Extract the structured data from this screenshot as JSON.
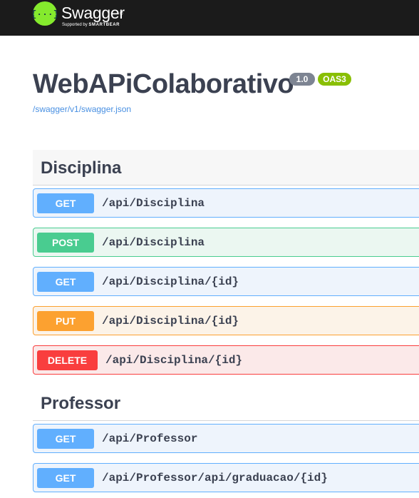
{
  "header": {
    "brand_name": "Swagger",
    "brand_tm": "®",
    "tagline_prefix": "Supported by",
    "tagline_brand": "SMARTBEAR",
    "brand_color": "#85ea2d",
    "icon": "swagger-logo-icon"
  },
  "info": {
    "title": "WebAPiColaborativo",
    "version_badge": "1.0",
    "oas_badge": "OAS3",
    "spec_url": "/swagger/v1/swagger.json"
  },
  "colors": {
    "get": "#61affe",
    "post": "#49cc90",
    "put": "#fca130",
    "delete": "#f93e3e"
  },
  "sections": [
    {
      "name": "Disciplina",
      "operations": [
        {
          "method": "GET",
          "path": "/api/Disciplina"
        },
        {
          "method": "POST",
          "path": "/api/Disciplina"
        },
        {
          "method": "GET",
          "path": "/api/Disciplina/{id}"
        },
        {
          "method": "PUT",
          "path": "/api/Disciplina/{id}"
        },
        {
          "method": "DELETE",
          "path": "/api/Disciplina/{id}"
        }
      ]
    },
    {
      "name": "Professor",
      "operations": [
        {
          "method": "GET",
          "path": "/api/Professor"
        },
        {
          "method": "GET",
          "path": "/api/Professor/api/graduacao/{id}"
        }
      ]
    }
  ]
}
